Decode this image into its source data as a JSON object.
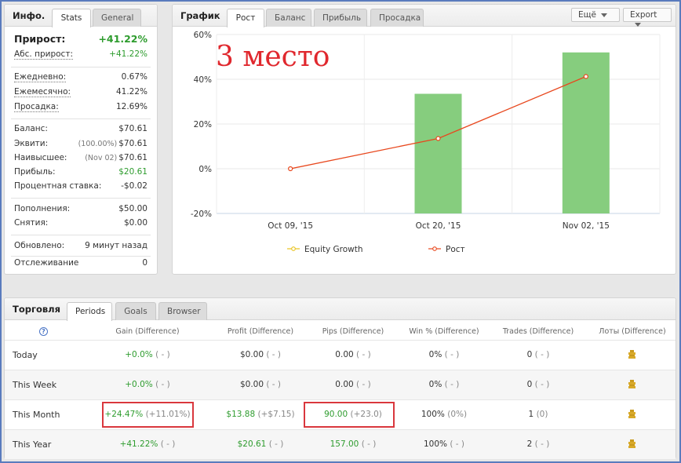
{
  "info": {
    "title": "Инфо.",
    "tabs": [
      "Stats",
      "General"
    ],
    "gain": {
      "label": "Прирост:",
      "value": "+41.22%"
    },
    "abs_gain": {
      "label": "Абс. прирост:",
      "value": "+41.22%"
    },
    "daily": {
      "label": "Ежедневно:",
      "value": "0.67%"
    },
    "monthly": {
      "label": "Ежемесячно:",
      "value": "41.22%"
    },
    "drawdown": {
      "label": "Просадка:",
      "value": "12.69%"
    },
    "balance": {
      "label": "Баланс:",
      "value": "$70.61"
    },
    "equity": {
      "label": "Эквити:",
      "sub": "(100.00%)",
      "value": "$70.61"
    },
    "highest": {
      "label": "Наивысшее:",
      "sub": "(Nov 02)",
      "value": "$70.61"
    },
    "profit": {
      "label": "Прибыль:",
      "value": "$20.61"
    },
    "interest": {
      "label": "Процентная ставка:",
      "value": "-$0.02"
    },
    "deposits": {
      "label": "Пополнения:",
      "value": "$50.00"
    },
    "withdrawals": {
      "label": "Снятия:",
      "value": "$0.00"
    },
    "updated": {
      "label": "Обновлено:",
      "value": "9 минут назад"
    },
    "tracking": {
      "label": "Отслеживание",
      "value": "0"
    }
  },
  "chart_panel": {
    "title": "График",
    "tabs": [
      "Рост",
      "Баланс",
      "Прибыль",
      "Просадка"
    ],
    "more_label": "Ещё",
    "export_label": "Export",
    "overlay_text": "3 место"
  },
  "chart_data": {
    "type": "bar",
    "categories": [
      "Oct 09, '15",
      "Oct 20, '15",
      "Nov 02, '15"
    ],
    "series": [
      {
        "name": "Equity Growth",
        "type": "bar",
        "color": "#86cd7e",
        "values": [
          0,
          33.5,
          52
        ]
      },
      {
        "name": "Рост",
        "type": "line",
        "color": "#e8481e",
        "values": [
          0,
          13.5,
          41.22
        ]
      }
    ],
    "legend": [
      {
        "name": "Equity Growth",
        "color": "#e8c31e"
      },
      {
        "name": "Рост",
        "color": "#e8481e"
      }
    ],
    "y_ticks": [
      "60%",
      "40%",
      "20%",
      "0%",
      "-20%"
    ],
    "ylim": [
      -20,
      60
    ],
    "grid": true,
    "legend_position": "bottom"
  },
  "trading": {
    "title": "Торговля",
    "tabs": [
      "Periods",
      "Goals",
      "Browser"
    ],
    "help_icon": "?",
    "columns": [
      "Gain (Difference)",
      "Profit (Difference)",
      "Pips (Difference)",
      "Win % (Difference)",
      "Trades (Difference)",
      "Лоты (Difference)"
    ],
    "rows": [
      {
        "name": "Today",
        "gain": "+0.0%",
        "gain_diff": "( - )",
        "profit": "$0.00",
        "profit_diff": "( - )",
        "pips": "0.00",
        "pips_diff": "( - )",
        "win": "0%",
        "win_diff": "( - )",
        "trades": "0",
        "trades_diff": "( - )"
      },
      {
        "name": "This Week",
        "gain": "+0.0%",
        "gain_diff": "( - )",
        "profit": "$0.00",
        "profit_diff": "( - )",
        "pips": "0.00",
        "pips_diff": "( - )",
        "win": "0%",
        "win_diff": "( - )",
        "trades": "0",
        "trades_diff": "( - )"
      },
      {
        "name": "This Month",
        "gain": "+24.47%",
        "gain_diff": "(+11.01%)",
        "profit": "$13.88",
        "profit_diff": "(+$7.15)",
        "pips": "90.00",
        "pips_diff": "(+23.0)",
        "win": "100%",
        "win_diff": "(0%)",
        "trades": "1",
        "trades_diff": "(0)"
      },
      {
        "name": "This Year",
        "gain": "+41.22%",
        "gain_diff": "( - )",
        "profit": "$20.61",
        "profit_diff": "( - )",
        "pips": "157.00",
        "pips_diff": "( - )",
        "win": "100%",
        "win_diff": "( - )",
        "trades": "2",
        "trades_diff": "( - )"
      }
    ]
  }
}
